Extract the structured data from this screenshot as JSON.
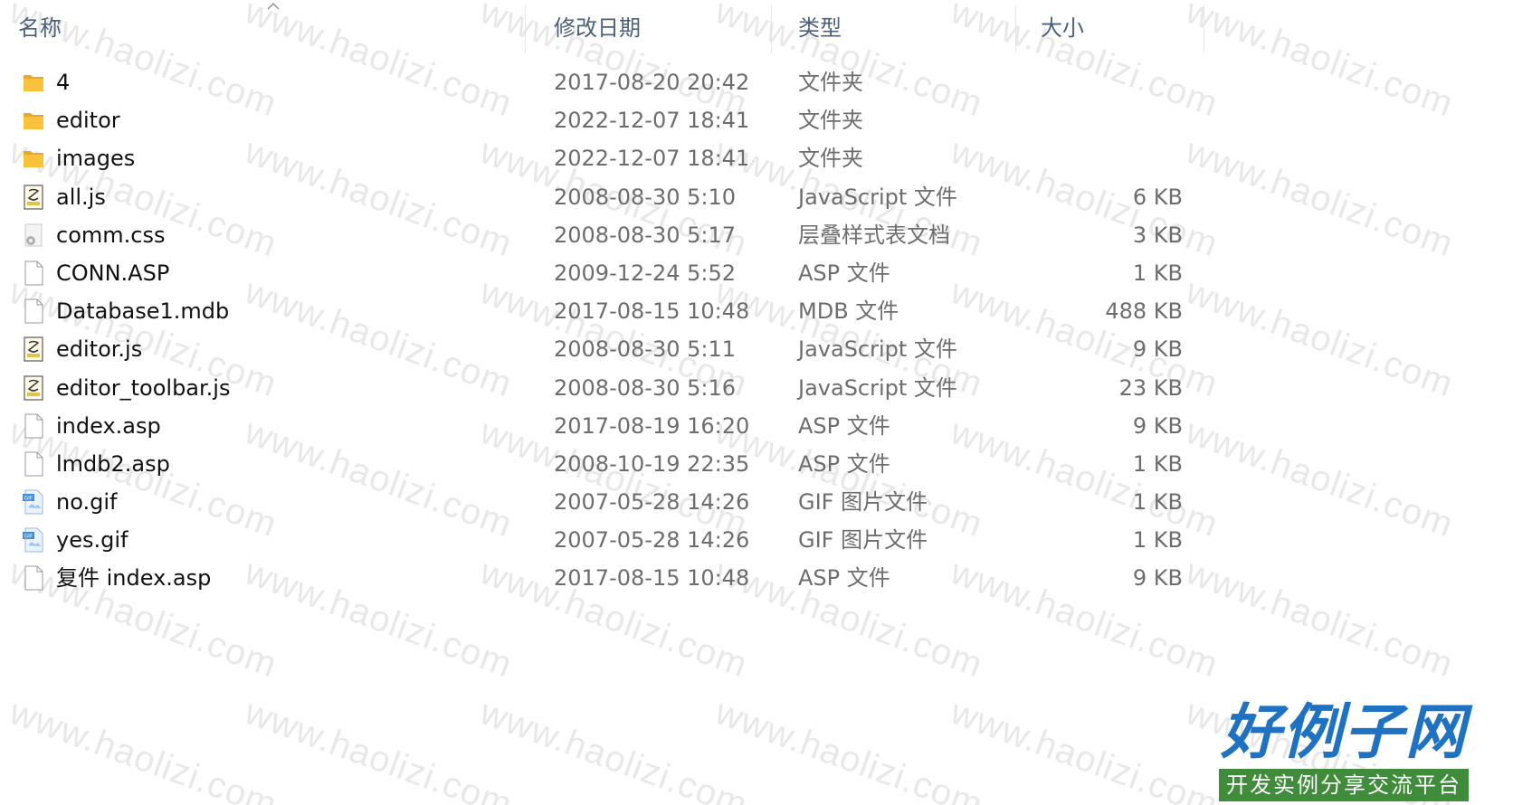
{
  "header": {
    "name": "名称",
    "date": "修改日期",
    "type": "类型",
    "size": "大小"
  },
  "files": [
    {
      "icon": "folder-icon",
      "name": "4",
      "date": "2017-08-20 20:42",
      "type": "文件夹",
      "size": ""
    },
    {
      "icon": "folder-icon",
      "name": "editor",
      "date": "2022-12-07 18:41",
      "type": "文件夹",
      "size": ""
    },
    {
      "icon": "folder-icon",
      "name": "images",
      "date": "2022-12-07 18:41",
      "type": "文件夹",
      "size": ""
    },
    {
      "icon": "js-file-icon",
      "name": "all.js",
      "date": "2008-08-30 5:10",
      "type": "JavaScript 文件",
      "size": "6 KB"
    },
    {
      "icon": "css-file-icon",
      "name": "comm.css",
      "date": "2008-08-30 5:17",
      "type": "层叠样式表文档",
      "size": "3 KB"
    },
    {
      "icon": "blank-file-icon",
      "name": "CONN.ASP",
      "date": "2009-12-24 5:52",
      "type": "ASP 文件",
      "size": "1 KB"
    },
    {
      "icon": "blank-file-icon",
      "name": "Database1.mdb",
      "date": "2017-08-15 10:48",
      "type": "MDB 文件",
      "size": "488 KB"
    },
    {
      "icon": "js-file-icon",
      "name": "editor.js",
      "date": "2008-08-30 5:11",
      "type": "JavaScript 文件",
      "size": "9 KB"
    },
    {
      "icon": "js-file-icon",
      "name": "editor_toolbar.js",
      "date": "2008-08-30 5:16",
      "type": "JavaScript 文件",
      "size": "23 KB"
    },
    {
      "icon": "blank-file-icon",
      "name": "index.asp",
      "date": "2017-08-19 16:20",
      "type": "ASP 文件",
      "size": "9 KB"
    },
    {
      "icon": "blank-file-icon",
      "name": "lmdb2.asp",
      "date": "2008-10-19 22:35",
      "type": "ASP 文件",
      "size": "1 KB"
    },
    {
      "icon": "gif-file-icon",
      "name": "no.gif",
      "date": "2007-05-28 14:26",
      "type": "GIF 图片文件",
      "size": "1 KB"
    },
    {
      "icon": "gif-file-icon",
      "name": "yes.gif",
      "date": "2007-05-28 14:26",
      "type": "GIF 图片文件",
      "size": "1 KB"
    },
    {
      "icon": "blank-file-icon",
      "name": "复件 index.asp",
      "date": "2017-08-15 10:48",
      "type": "ASP 文件",
      "size": "9 KB"
    }
  ],
  "watermark": "www.haolizi.com",
  "logo": {
    "main": "好例子网",
    "sub": "开发实例分享交流平台"
  },
  "colors": {
    "header_text": "#4c607a",
    "folder": "#f8c33a",
    "logo_blue": "#1d72c4",
    "logo_green": "#3f8d3a"
  }
}
